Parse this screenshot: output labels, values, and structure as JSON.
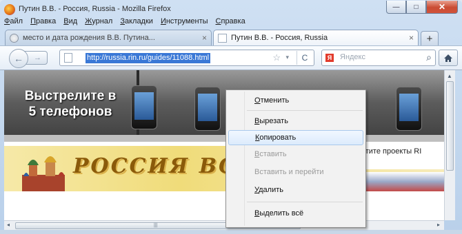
{
  "window": {
    "title": "Путин В.В. - Россия, Russia - Mozilla Firefox",
    "controls": {
      "minimize": "—",
      "maximize": "□",
      "close": "✕"
    }
  },
  "menubar": {
    "items": [
      "Файл",
      "Правка",
      "Вид",
      "Журнал",
      "Закладки",
      "Инструменты",
      "Справка"
    ]
  },
  "tabs": [
    {
      "label": "место и дата рождения В.В. Путина...",
      "close": "×",
      "active": false
    },
    {
      "label": "Путин В.В. - Россия, Russia",
      "close": "×",
      "active": true
    }
  ],
  "newtab": {
    "label": "+"
  },
  "navbar": {
    "back": "←",
    "forward": "→",
    "url": "http://russia.rin.ru/guides/11088.html",
    "star": "☆",
    "dropdown": "▾",
    "reload": "C",
    "search": {
      "engine_glyph": "Я",
      "placeholder": "Яндекс",
      "search_glyph": "⌕"
    }
  },
  "page": {
    "banner_ad": {
      "line1": "Выстрелите в",
      "line2": "5 телефонов"
    },
    "banner_russia": {
      "title": "РОССИЯ ВСЕ"
    },
    "side_text": "етите проекты RI"
  },
  "scrollbars": {
    "up": "▲",
    "left": "◂",
    "right": "▸",
    "grip": "|||"
  },
  "context_menu": {
    "items": [
      {
        "label": "Отменить",
        "disabled": false
      },
      {
        "label": "Вырезать",
        "disabled": false
      },
      {
        "label": "Копировать",
        "disabled": false,
        "highlighted": true
      },
      {
        "label": "Вставить",
        "disabled": true
      },
      {
        "label": "Вставить и перейти",
        "disabled": true
      },
      {
        "label": "Удалить",
        "disabled": false
      },
      {
        "label": "Выделить всё",
        "disabled": false
      }
    ]
  },
  "colors": {
    "url_selection": "#3a78d6",
    "close_button": "#c94b33",
    "menu_highlight": "#dcebfc"
  }
}
